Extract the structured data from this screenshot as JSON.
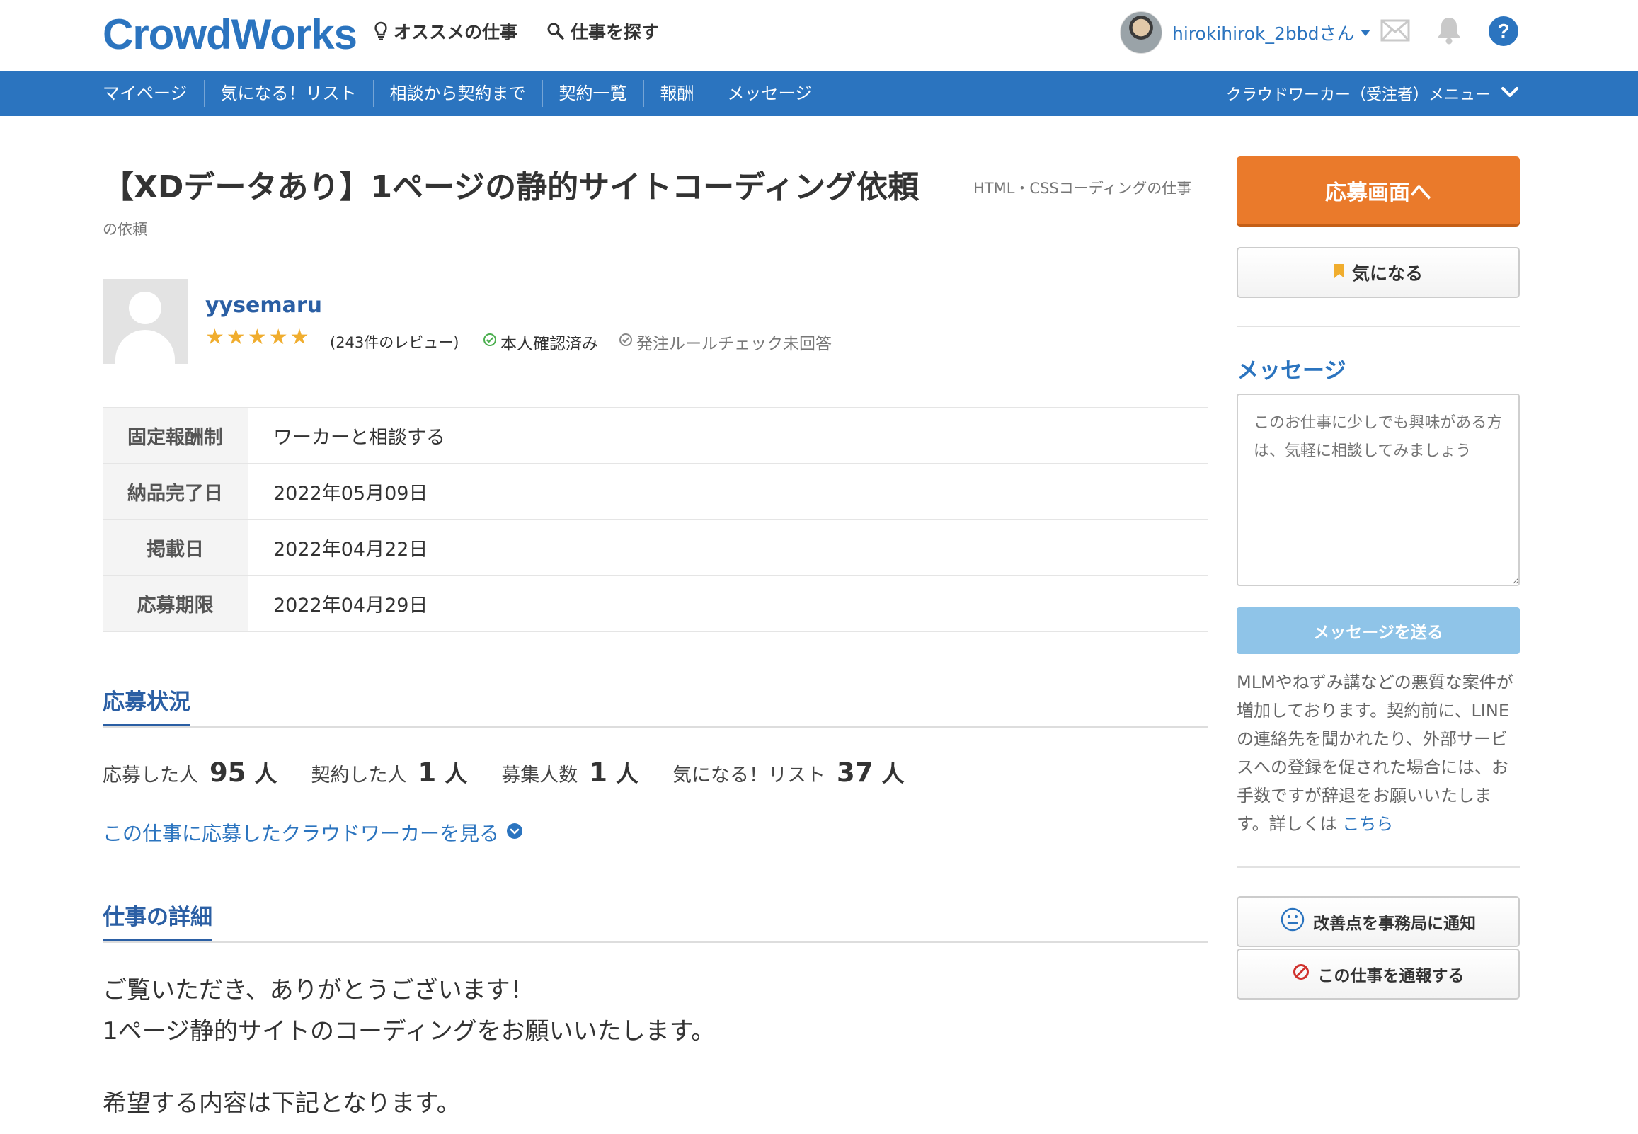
{
  "header": {
    "logo": "CrowdWorks",
    "recommended_label": "オススメの仕事",
    "search_label": "仕事を探す",
    "username": "hirokihirok_2bbdさん"
  },
  "nav": {
    "items": [
      "マイページ",
      "気になる！リスト",
      "相談から契約まで",
      "契約一覧",
      "報酬",
      "メッセージ"
    ],
    "worker_menu": "クラウドワーカー（受注者）メニュー"
  },
  "job": {
    "title": "【XDデータあり】1ページの静的サイトコーディング依頼",
    "category_line1": "HTML・CSSコーディングの仕事",
    "category_line2": "の依頼"
  },
  "client": {
    "name": "yysemaru",
    "rating": 5,
    "stars": [
      "★",
      "★",
      "★",
      "★",
      "★"
    ],
    "reviews": "(243件のレビュー)",
    "verified": "本人確認済み",
    "rule_check": "発注ルールチェック未回答"
  },
  "info": [
    {
      "label": "固定報酬制",
      "value": "ワーカーと相談する"
    },
    {
      "label": "納品完了日",
      "value": "2022年05月09日"
    },
    {
      "label": "掲載日",
      "value": "2022年04月22日"
    },
    {
      "label": "応募期限",
      "value": "2022年04月29日"
    }
  ],
  "status": {
    "title": "応募状況",
    "applied_label": "応募した人",
    "applied_value": "95",
    "applied_unit": "人",
    "contracted_label": "契約した人",
    "contracted_value": "1",
    "contracted_unit": "人",
    "recruit_label": "募集人数",
    "recruit_value": "1",
    "recruit_unit": "人",
    "fav_label": "気になる！リスト",
    "fav_value": "37",
    "fav_unit": "人",
    "applicants_link": "この仕事に応募したクラウドワーカーを見る"
  },
  "details": {
    "title": "仕事の詳細",
    "line1": "ご覧いただき、ありがとうございます！",
    "line2": "1ページ静的サイトのコーディングをお願いいたします。",
    "line3": "希望する内容は下記となります。"
  },
  "sidebar": {
    "apply_button": "応募画面へ",
    "fav_button": "気になる",
    "message_title": "メッセージ",
    "message_placeholder": "このお仕事に少しでも興味がある方は、気軽に相談してみましょう",
    "send_button": "メッセージを送る",
    "warning_text": "MLMやねずみ講などの悪質な案件が増加しております。契約前に、LINEの連絡先を聞かれたり、外部サービスへの登録を促された場合には、お手数ですが辞退をお願いいたします。詳しくは",
    "warning_link": "こちら",
    "improve_button": "改善点を事務局に通知",
    "report_button": "この仕事を通報する"
  },
  "colors": {
    "brand_blue": "#2b74bf",
    "apply_orange": "#ea7a2b",
    "star_gold": "#f0ad2e",
    "send_disabled": "#8fc4e8"
  },
  "icons": {
    "recommended": "lightbulb-icon",
    "search": "search-icon",
    "mail": "mail-icon",
    "notifications": "bell-icon",
    "help": "help-icon"
  }
}
